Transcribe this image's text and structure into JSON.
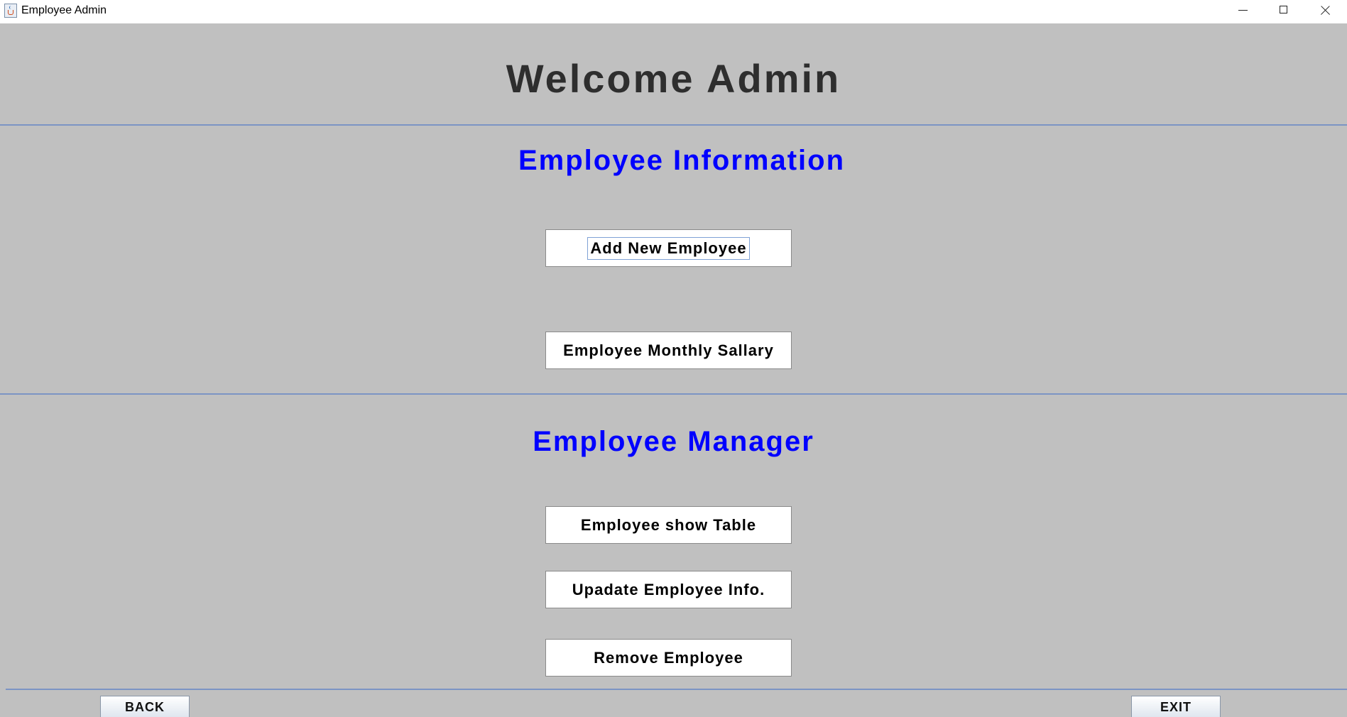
{
  "window": {
    "title": "Employee Admin",
    "icon": "java-cup-icon"
  },
  "header": {
    "welcome": "Welcome Admin"
  },
  "info_section": {
    "heading": "Employee Information",
    "buttons": [
      "Add New Employee",
      "Employee Monthly Sallary"
    ]
  },
  "manager_section": {
    "heading": "Employee Manager",
    "buttons": [
      "Employee show Table",
      "Upadate Employee Info.",
      "Remove Employee"
    ]
  },
  "footer": {
    "back_label": "BACK",
    "exit_label": "EXIT"
  },
  "colors": {
    "background": "#c0c0c0",
    "heading_blue": "#0000ff",
    "welcome_text": "#2e2e2e",
    "divider": "#7c94c4"
  }
}
